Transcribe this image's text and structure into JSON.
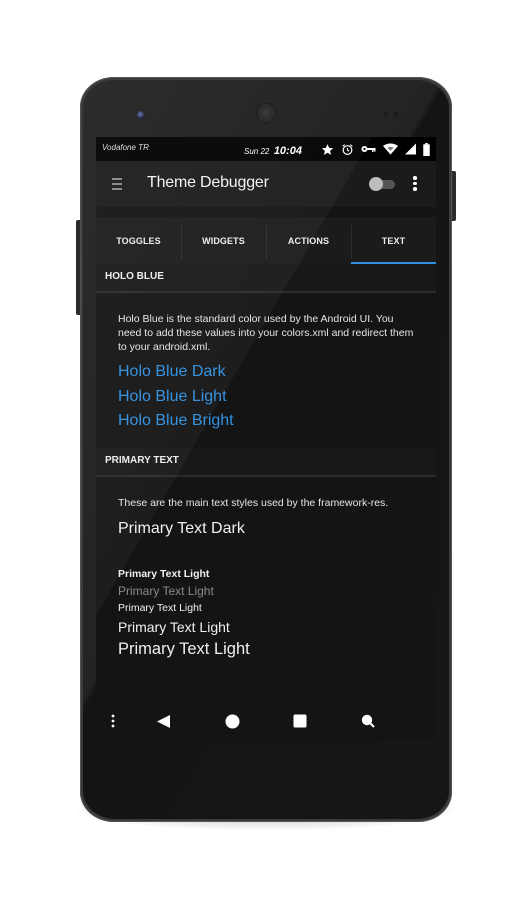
{
  "status_bar": {
    "carrier": "Vodafone TR",
    "date": "Sun 22",
    "time": "10:04",
    "icons": [
      "star-icon",
      "alarm-icon",
      "key-icon",
      "wifi-icon",
      "signal-icon",
      "battery-icon"
    ]
  },
  "app_bar": {
    "menu_icon": "hamburger-icon",
    "title": "Theme Debugger",
    "switch_on": false,
    "overflow_icon": "more-vert-icon"
  },
  "tabs": [
    {
      "label": "TOGGLES",
      "active": false
    },
    {
      "label": "WIDGETS",
      "active": false
    },
    {
      "label": "ACTIONS",
      "active": false
    },
    {
      "label": "TEXT",
      "active": true
    }
  ],
  "sections": {
    "holo_blue": {
      "header": "HOLO BLUE",
      "description": "Holo Blue is the standard color used by the Android UI. You need to add these values into your colors.xml and redirect them to your android.xml.",
      "samples": [
        "Holo Blue Dark",
        "Holo Blue Light",
        "Holo Blue Bright"
      ]
    },
    "primary_text": {
      "header": "PRIMARY TEXT",
      "description": "These are the main text styles used by the framework-res.",
      "dark_sample": "Primary Text Dark",
      "light_samples": [
        "Primary Text Light",
        "Primary Text Light",
        "Primary Text Light",
        "Primary Text Light",
        "Primary Text Light"
      ]
    }
  },
  "nav_bar": {
    "buttons": [
      "menu-dots-icon",
      "back-icon",
      "home-icon",
      "recents-icon",
      "search-icon"
    ]
  },
  "colors": {
    "accent": "#2f8fe0",
    "background": "#141414",
    "text_primary": "#f0f0f0",
    "text_secondary": "#8a8a8a"
  }
}
